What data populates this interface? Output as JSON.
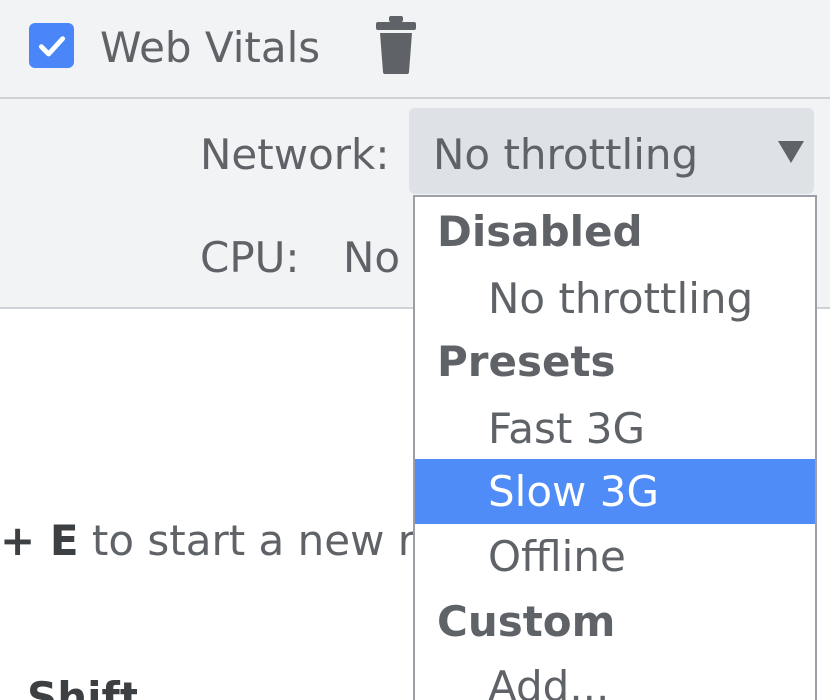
{
  "toolbar": {
    "web_vitals_checked": true,
    "web_vitals_label": "Web Vitals",
    "checkbox_icon": "check-icon",
    "trash_icon": "trash-icon"
  },
  "settings": {
    "network_label": "Network:",
    "network_value": "No throttling",
    "cpu_label": "CPU:",
    "cpu_value": "No"
  },
  "hint": {
    "key": "+ E",
    "text": " to start a new re"
  },
  "dropdown": {
    "groups": [
      {
        "label": "Disabled",
        "items": [
          "No throttling"
        ]
      },
      {
        "label": "Presets",
        "items": [
          "Fast 3G",
          "Slow 3G",
          "Offline"
        ]
      },
      {
        "label": "Custom",
        "items": [
          "Add..."
        ]
      }
    ],
    "highlighted_item": "Slow 3G"
  },
  "colors": {
    "accent": "#4a86f7",
    "highlight": "#4f8cf7",
    "toolbar_bg": "#f1f3f4",
    "text": "#5f6368"
  }
}
